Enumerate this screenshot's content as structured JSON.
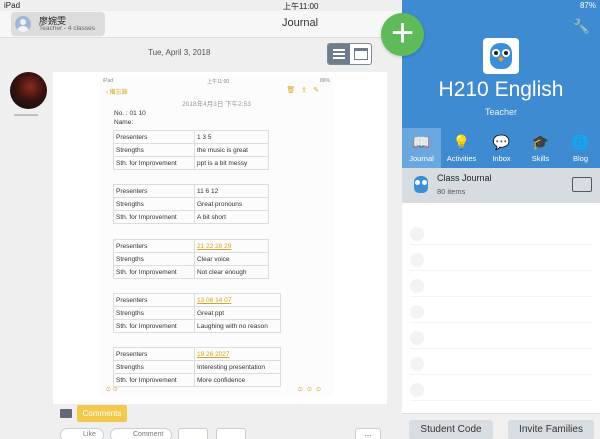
{
  "status_bar": {
    "device": "iPad",
    "time": "上午11:00",
    "battery": "87%"
  },
  "header": {
    "user_name": "廖婉雯",
    "user_subtitle": "Teacher - 4 classes",
    "title": "Journal"
  },
  "post": {
    "date": "Tue, April 3, 2018",
    "screenshot": {
      "status_left": "iPad",
      "status_time": "上午11:00",
      "status_battery": "86%",
      "back_label": "備忘錄",
      "note_date": "2018年4月3日 下午2:53",
      "line_no": "No. : 01 10",
      "line_name": "Name:",
      "tables": [
        {
          "rows": [
            [
              "Presenters",
              "1 3 5"
            ],
            [
              "Strengths",
              "the music is great"
            ],
            [
              "Sth. for Improvement",
              "ppt is a bit messy"
            ]
          ]
        },
        {
          "rows": [
            [
              "Presenters",
              "11 6 12"
            ],
            [
              "Strengths",
              "Great pronouns"
            ],
            [
              "Sth. for Improvement",
              "A bit short"
            ]
          ]
        },
        {
          "rows": [
            [
              "Presenters",
              "21 22 28 29"
            ],
            [
              "Strengths",
              "Clear voice"
            ],
            [
              "Sth. for Improvement",
              "Not clear enough"
            ]
          ]
        },
        {
          "rows": [
            [
              "Presenters",
              "13 08 14 07"
            ],
            [
              "Strengths",
              "Great ppt"
            ],
            [
              "Sth. for Improvement",
              "Laughing with no reason"
            ]
          ]
        },
        {
          "rows": [
            [
              "Presenters",
              "19 26 2027"
            ],
            [
              "Strengths",
              "Interesting presentation"
            ],
            [
              "Sth. for Improvement",
              "More confidence"
            ]
          ]
        }
      ]
    },
    "comments_tag": "Comments",
    "actions": {
      "like": "Like",
      "comment": "Comment",
      "more": "..."
    }
  },
  "panel": {
    "class_name": "H210 English",
    "role": "Teacher",
    "tabs": [
      {
        "label": "Journal",
        "icon": "book-icon"
      },
      {
        "label": "Activities",
        "icon": "bulb-icon"
      },
      {
        "label": "Inbox",
        "icon": "chat-icon"
      },
      {
        "label": "Skills",
        "icon": "graduation-cap-icon"
      },
      {
        "label": "Blog",
        "icon": "globe-icon"
      }
    ],
    "class_journal": {
      "title": "Class Journal",
      "count": "80 items"
    },
    "buttons": {
      "student_code": "Student Code",
      "invite_families": "Invite Families"
    }
  },
  "colors": {
    "accent_blue": "#3e8bd1",
    "add_green": "#5fba5a",
    "comments_yellow": "#f2c94c"
  }
}
